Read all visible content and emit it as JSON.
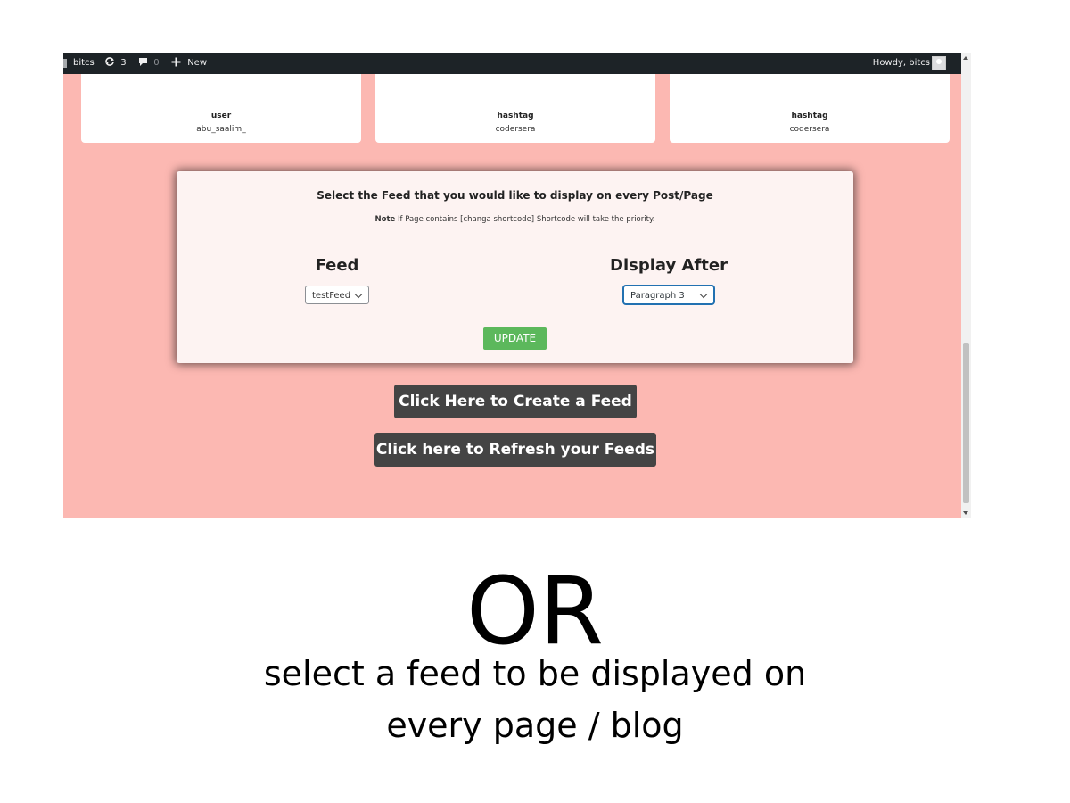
{
  "adminbar": {
    "site_name": "bitcs",
    "updates_count": "3",
    "comments_count": "0",
    "new_label": "New",
    "greeting": "Howdy, bitcs"
  },
  "cards": [
    {
      "type": "user",
      "name": "abu_saalim_"
    },
    {
      "type": "hashtag",
      "name": "codersera"
    },
    {
      "type": "hashtag",
      "name": "codersera"
    }
  ],
  "panel": {
    "title": "Select the Feed that you would like to display on every Post/Page",
    "note_label": "Note",
    "note_text": " If Page contains [changa shortcode] Shortcode will take the priority.",
    "feed_label": "Feed",
    "feed_value": "testFeed",
    "display_label": "Display After",
    "display_value": "Paragraph 3",
    "update_label": "UPDATE"
  },
  "buttons": {
    "create_feed": "Click Here to Create a Feed",
    "refresh_feeds": "Click here to Refresh your Feeds"
  },
  "overlay": {
    "or_text": "OR",
    "caption_line1": "select a feed to be displayed on",
    "caption_line2": "every page / blog"
  },
  "colors": {
    "page_bg": "#fcb8b2",
    "adminbar_bg": "#1d2327",
    "update_button": "#5cb85c",
    "dark_button": "#444444"
  }
}
